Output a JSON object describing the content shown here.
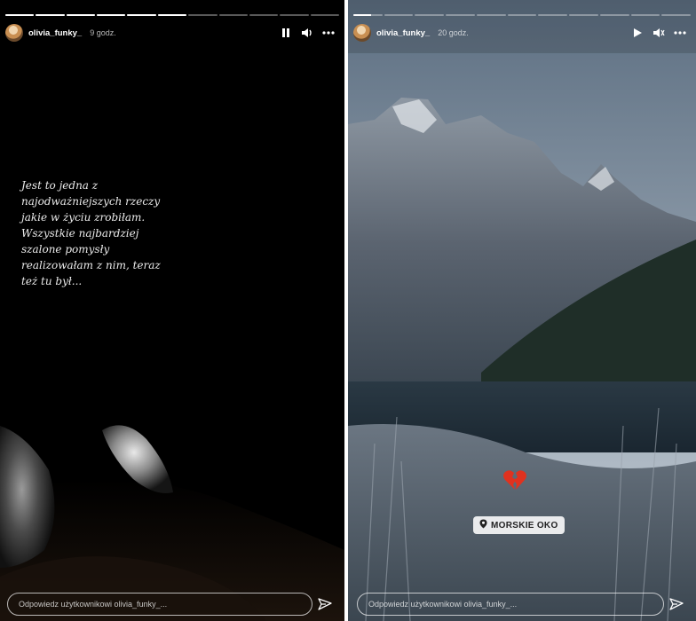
{
  "left_story": {
    "progress": [
      1,
      1,
      1,
      1,
      1,
      1,
      0,
      0,
      0,
      0,
      0
    ],
    "username": "olivia_funky_",
    "time": "9 godz.",
    "text_lines": [
      "Jest to jedna z",
      "najodważniejszych rzeczy",
      "jakie w życiu zrobiłam.",
      "Wszystkie najbardziej",
      "szalone pomysły",
      "realizowałam z nim, teraz",
      "też tu był..."
    ],
    "reply_placeholder": "Odpowiedz użytkownikowi olivia_funky_..."
  },
  "right_story": {
    "progress": [
      0.6,
      0,
      0,
      0,
      0,
      0,
      0,
      0,
      0,
      0,
      0
    ],
    "username": "olivia_funky_",
    "time": "20 godz.",
    "location_sticker": "MORSKIE OKO",
    "reply_placeholder": "Odpowiedz użytkownikowi olivia_funky_..."
  },
  "icons": {
    "pause": "pause-icon",
    "play": "play-icon",
    "volume": "volume-icon",
    "more": "more-icon",
    "send": "send-icon",
    "heart": "broken-heart-icon",
    "pin": "location-pin-icon"
  },
  "colors": {
    "heart": "#e0321f",
    "text": "#ffffff"
  }
}
